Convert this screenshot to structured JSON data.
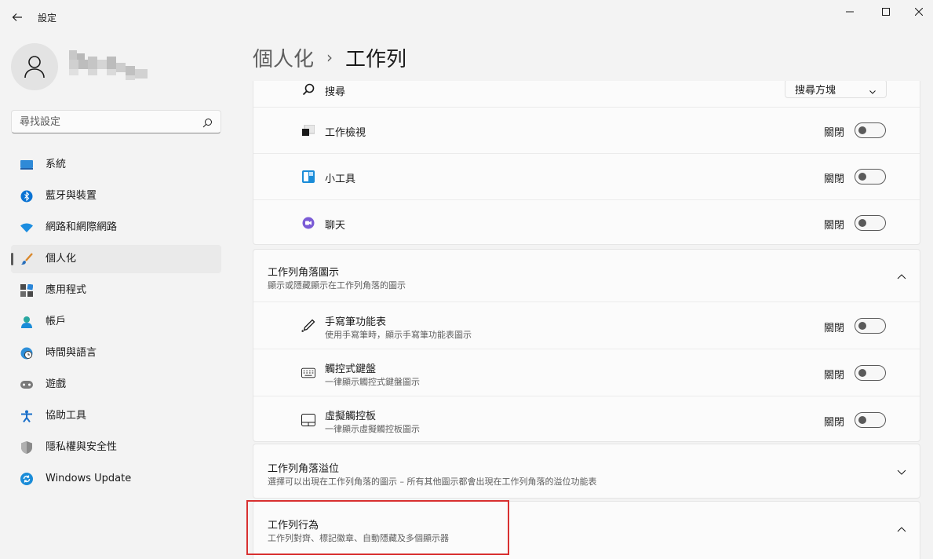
{
  "window": {
    "title": "設定"
  },
  "profile": {
    "name_redacted": true
  },
  "search": {
    "placeholder": "尋找設定"
  },
  "sidebar": {
    "items": [
      {
        "label": "系統",
        "icon": "system-icon"
      },
      {
        "label": "藍牙與裝置",
        "icon": "bluetooth-icon"
      },
      {
        "label": "網路和網際網路",
        "icon": "wifi-icon"
      },
      {
        "label": "個人化",
        "icon": "brush-icon",
        "active": true
      },
      {
        "label": "應用程式",
        "icon": "apps-icon"
      },
      {
        "label": "帳戶",
        "icon": "account-icon"
      },
      {
        "label": "時間與語言",
        "icon": "globe-clock-icon"
      },
      {
        "label": "遊戲",
        "icon": "gamepad-icon"
      },
      {
        "label": "協助工具",
        "icon": "accessibility-icon"
      },
      {
        "label": "隱私權與安全性",
        "icon": "shield-icon"
      },
      {
        "label": "Windows Update",
        "icon": "update-icon"
      }
    ]
  },
  "breadcrumb": {
    "parent": "個人化",
    "separator": "›",
    "current": "工作列"
  },
  "taskbar_items": {
    "search": {
      "label": "搜尋",
      "value": "搜尋方塊"
    },
    "task_view": {
      "label": "工作檢視",
      "state": "關閉"
    },
    "widgets": {
      "label": "小工具",
      "state": "關閉"
    },
    "chat": {
      "label": "聊天",
      "state": "關閉"
    }
  },
  "corner_icons": {
    "title": "工作列角落圖示",
    "desc": "顯示或隱藏顯示在工作列角落的圖示",
    "pen": {
      "label": "手寫筆功能表",
      "desc": "使用手寫筆時，顯示手寫筆功能表圖示",
      "state": "關閉"
    },
    "keyboard": {
      "label": "觸控式鍵盤",
      "desc": "一律顯示觸控式鍵盤圖示",
      "state": "關閉"
    },
    "touchpad": {
      "label": "虛擬觸控板",
      "desc": "一律顯示虛擬觸控板圖示",
      "state": "關閉"
    }
  },
  "corner_overflow": {
    "title": "工作列角落溢位",
    "desc": "選擇可以出現在工作列角落的圖示 – 所有其他圖示都會出現在工作列角落的溢位功能表"
  },
  "behaviors": {
    "title": "工作列行為",
    "desc": "工作列對齊、標記徽章、自動隱藏及多個顯示器"
  },
  "colors": {
    "accent": "#0067c0",
    "highlight": "#d83030"
  }
}
